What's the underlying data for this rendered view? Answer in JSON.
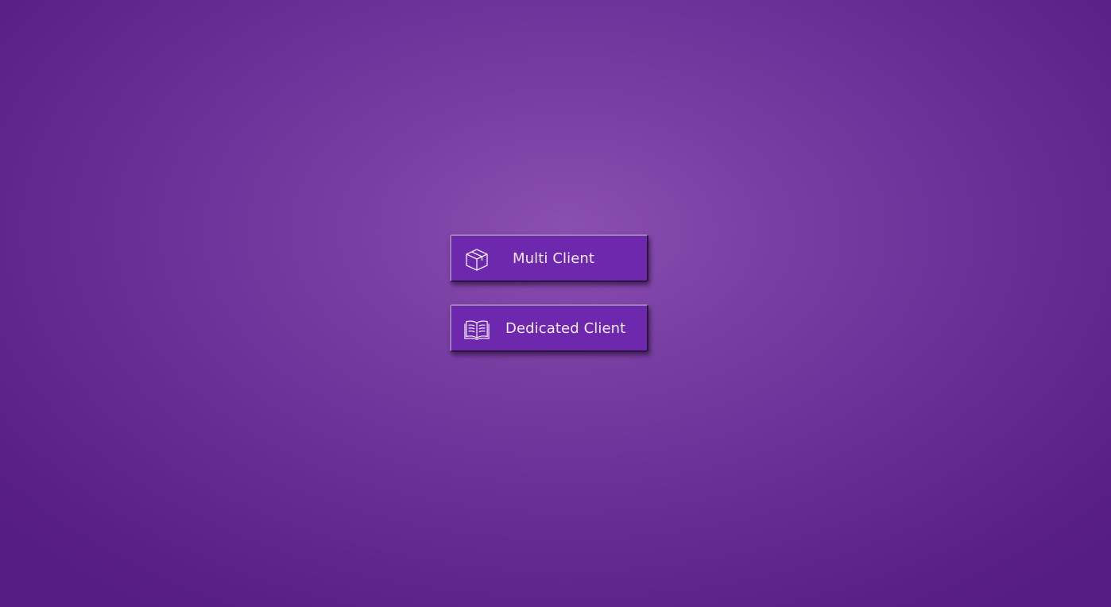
{
  "background": {
    "center_color": "#8a4fb0",
    "edge_color": "#541c84"
  },
  "menu": {
    "buttons": [
      {
        "label": "Multi Client",
        "icon": "cube-box-icon",
        "color": "#6e28ad"
      },
      {
        "label": "Dedicated Client",
        "icon": "open-book-icon",
        "color": "#6e28ad"
      }
    ]
  }
}
